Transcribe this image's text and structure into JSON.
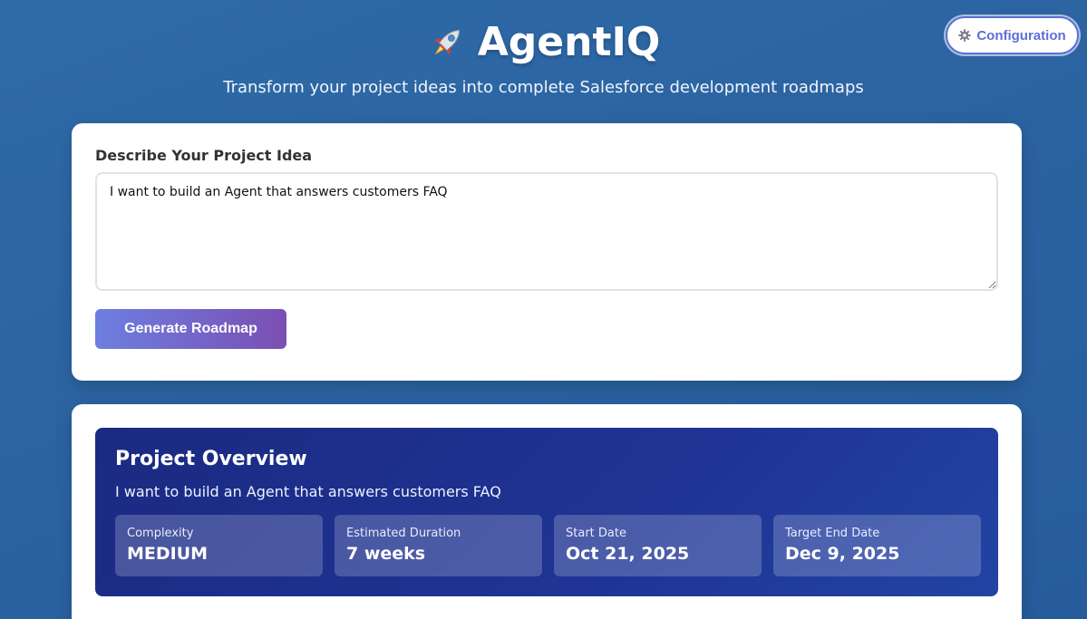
{
  "header": {
    "title": "AgentIQ",
    "title_icon": "rocket-icon",
    "subtitle": "Transform your project ideas into complete Salesforce development roadmaps"
  },
  "config_button": {
    "label": "Configuration",
    "icon": "gear-icon"
  },
  "input_card": {
    "label": "Describe Your Project Idea",
    "textarea_value": "I want to build an Agent that answers customers FAQ",
    "generate_label": "Generate Roadmap"
  },
  "overview": {
    "title": "Project Overview",
    "description": "I want to build an Agent that answers customers FAQ",
    "stats": [
      {
        "label": "Complexity",
        "value": "MEDIUM"
      },
      {
        "label": "Estimated Duration",
        "value": "7 weeks"
      },
      {
        "label": "Start Date",
        "value": "Oct 21, 2025"
      },
      {
        "label": "Target End Date",
        "value": "Dec 9, 2025"
      }
    ]
  },
  "colors": {
    "background": "#2c64a2",
    "accent": "#5b6fd6",
    "button_gradient_start": "#6c7fe0",
    "button_gradient_end": "#7b4fb3",
    "overview_bg": "#1f3494"
  }
}
